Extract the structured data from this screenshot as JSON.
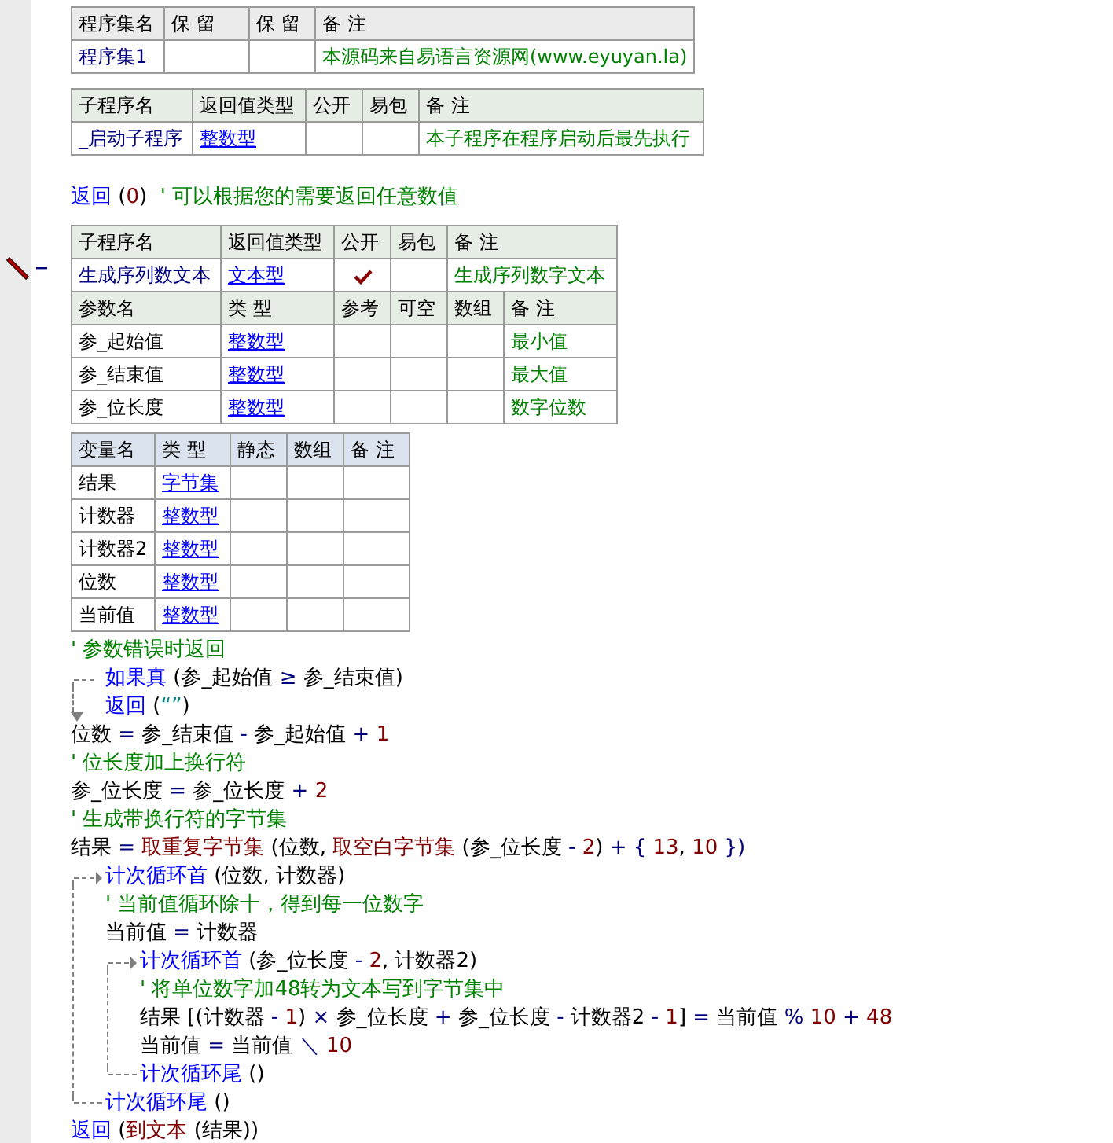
{
  "assembly": {
    "columns": [
      "程序集名",
      "保 留",
      "保 留",
      "备 注"
    ],
    "name": "程序集1",
    "remark": "本源码来自易语言资源网(www.eyuyan.la)"
  },
  "startup_sub": {
    "columns": [
      "子程序名",
      "返回值类型",
      "公开",
      "易包",
      "备 注"
    ],
    "name": "_启动子程序",
    "return_type": "整数型",
    "public": false,
    "easy_package": false,
    "remark": "本子程序在程序启动后最先执行"
  },
  "startup_code": [
    {
      "kind": "line",
      "tokens": [
        {
          "text": "返回",
          "kind": "kw"
        },
        {
          "text": " (",
          "kind": "p"
        },
        {
          "text": "0",
          "kind": "num"
        },
        {
          "text": ")",
          "kind": "p"
        },
        {
          "text": "  ' 可以根据您的需要返回任意数值",
          "kind": "cm"
        }
      ]
    }
  ],
  "sub": {
    "columns": [
      "子程序名",
      "返回值类型",
      "公开",
      "易包",
      "备 注"
    ],
    "name": "生成序列数文本",
    "return_type": "文本型",
    "public": true,
    "easy_package": false,
    "remark": "生成序列数字文本",
    "param_columns": [
      "参数名",
      "类 型",
      "参考",
      "可空",
      "数组",
      "备 注"
    ],
    "params": [
      {
        "name": "参_起始值",
        "type": "整数型",
        "by_ref": false,
        "optional": false,
        "array": false,
        "remark": "最小值"
      },
      {
        "name": "参_结束值",
        "type": "整数型",
        "by_ref": false,
        "optional": false,
        "array": false,
        "remark": "最大值"
      },
      {
        "name": "参_位长度",
        "type": "整数型",
        "by_ref": false,
        "optional": false,
        "array": false,
        "remark": "数字位数"
      }
    ]
  },
  "locals": {
    "columns": [
      "变量名",
      "类 型",
      "静态",
      "数组",
      "备 注"
    ],
    "vars": [
      {
        "name": "结果",
        "type": "字节集",
        "static": false,
        "array": false
      },
      {
        "name": "计数器",
        "type": "整数型",
        "static": false,
        "array": false
      },
      {
        "name": "计数器2",
        "type": "整数型",
        "static": false,
        "array": false
      },
      {
        "name": "位数",
        "type": "整数型",
        "static": false,
        "array": false
      },
      {
        "name": "当前值",
        "type": "整数型",
        "static": false,
        "array": false
      }
    ]
  },
  "code": [
    {
      "kind": "line",
      "tokens": [
        {
          "text": "' 参数错误时返回",
          "kind": "cm"
        }
      ]
    },
    {
      "kind": "if",
      "tokens": [
        {
          "text": "如果真",
          "kind": "kw"
        },
        {
          "text": " (",
          "kind": "p"
        },
        {
          "text": "参_起始值",
          "kind": "id"
        },
        {
          "text": " ≥ ",
          "kind": "op"
        },
        {
          "text": "参_结束值",
          "kind": "id"
        },
        {
          "text": ")",
          "kind": "p"
        }
      ],
      "children": [
        {
          "kind": "line",
          "tokens": [
            {
              "text": "返回",
              "kind": "kw"
            },
            {
              "text": " (",
              "kind": "p"
            },
            {
              "text": "“”",
              "kind": "str"
            },
            {
              "text": ")",
              "kind": "p"
            }
          ]
        }
      ]
    },
    {
      "kind": "line",
      "tokens": [
        {
          "text": "位数",
          "kind": "id"
        },
        {
          "text": " = ",
          "kind": "op"
        },
        {
          "text": "参_结束值",
          "kind": "id"
        },
        {
          "text": " - ",
          "kind": "op"
        },
        {
          "text": "参_起始值",
          "kind": "id"
        },
        {
          "text": " + ",
          "kind": "op"
        },
        {
          "text": "1",
          "kind": "num"
        }
      ]
    },
    {
      "kind": "line",
      "tokens": [
        {
          "text": "' 位长度加上换行符",
          "kind": "cm"
        }
      ]
    },
    {
      "kind": "line",
      "tokens": [
        {
          "text": "参_位长度",
          "kind": "id"
        },
        {
          "text": " = ",
          "kind": "op"
        },
        {
          "text": "参_位长度",
          "kind": "id"
        },
        {
          "text": " + ",
          "kind": "op"
        },
        {
          "text": "2",
          "kind": "num"
        }
      ]
    },
    {
      "kind": "line",
      "tokens": [
        {
          "text": "' 生成带换行符的字节集",
          "kind": "cm"
        }
      ]
    },
    {
      "kind": "line",
      "tokens": [
        {
          "text": "结果",
          "kind": "id"
        },
        {
          "text": " = ",
          "kind": "op"
        },
        {
          "text": "取重复字节集",
          "kind": "fn"
        },
        {
          "text": " (位数, ",
          "kind": "p"
        },
        {
          "text": "取空白字节集",
          "kind": "fn"
        },
        {
          "text": " (参_位长度",
          "kind": "p"
        },
        {
          "text": " - ",
          "kind": "op"
        },
        {
          "text": "2",
          "kind": "num"
        },
        {
          "text": ")",
          "kind": "p"
        },
        {
          "text": " + { ",
          "kind": "op"
        },
        {
          "text": "13",
          "kind": "num"
        },
        {
          "text": ", ",
          "kind": "p"
        },
        {
          "text": "10",
          "kind": "num"
        },
        {
          "text": " })",
          "kind": "op"
        }
      ]
    },
    {
      "kind": "loop",
      "tokens": [
        {
          "text": "计次循环首",
          "kind": "kw"
        },
        {
          "text": " (位数, 计数器)",
          "kind": "p"
        }
      ],
      "children": [
        {
          "kind": "line",
          "tokens": [
            {
              "text": "' 当前值循环除十，得到每一位数字",
              "kind": "cm"
            }
          ]
        },
        {
          "kind": "line",
          "tokens": [
            {
              "text": "当前值",
              "kind": "id"
            },
            {
              "text": " = ",
              "kind": "op"
            },
            {
              "text": "计数器",
              "kind": "id"
            }
          ]
        },
        {
          "kind": "loop",
          "tokens": [
            {
              "text": "计次循环首",
              "kind": "kw"
            },
            {
              "text": " (参_位长度",
              "kind": "p"
            },
            {
              "text": " - ",
              "kind": "op"
            },
            {
              "text": "2",
              "kind": "num"
            },
            {
              "text": ", 计数器2)",
              "kind": "p"
            }
          ],
          "children": [
            {
              "kind": "line",
              "tokens": [
                {
                  "text": "' 将单位数字加48转为文本写到字节集中",
                  "kind": "cm"
                }
              ]
            },
            {
              "kind": "line",
              "tokens": [
                {
                  "text": "结果 [(计数器",
                  "kind": "id"
                },
                {
                  "text": " - ",
                  "kind": "op"
                },
                {
                  "text": "1",
                  "kind": "num"
                },
                {
                  "text": ")",
                  "kind": "p"
                },
                {
                  "text": " × ",
                  "kind": "op"
                },
                {
                  "text": "参_位长度",
                  "kind": "id"
                },
                {
                  "text": " + ",
                  "kind": "op"
                },
                {
                  "text": "参_位长度",
                  "kind": "id"
                },
                {
                  "text": " - ",
                  "kind": "op"
                },
                {
                  "text": "计数器2",
                  "kind": "id"
                },
                {
                  "text": " - ",
                  "kind": "op"
                },
                {
                  "text": "1",
                  "kind": "num"
                },
                {
                  "text": "]",
                  "kind": "p"
                },
                {
                  "text": " = ",
                  "kind": "op"
                },
                {
                  "text": "当前值",
                  "kind": "id"
                },
                {
                  "text": " % ",
                  "kind": "op"
                },
                {
                  "text": "10",
                  "kind": "num"
                },
                {
                  "text": " + ",
                  "kind": "op"
                },
                {
                  "text": "48",
                  "kind": "num"
                }
              ]
            },
            {
              "kind": "line",
              "tokens": [
                {
                  "text": "当前值",
                  "kind": "id"
                },
                {
                  "text": " = ",
                  "kind": "op"
                },
                {
                  "text": "当前值",
                  "kind": "id"
                },
                {
                  "text": " ＼ ",
                  "kind": "op"
                },
                {
                  "text": "10",
                  "kind": "num"
                }
              ]
            }
          ],
          "end": [
            {
              "text": "计次循环尾",
              "kind": "kw"
            },
            {
              "text": " ()",
              "kind": "p"
            }
          ]
        }
      ],
      "end": [
        {
          "text": "计次循环尾",
          "kind": "kw"
        },
        {
          "text": " ()",
          "kind": "p"
        }
      ]
    },
    {
      "kind": "line",
      "tokens": [
        {
          "text": "返回",
          "kind": "kw"
        },
        {
          "text": " (",
          "kind": "p"
        },
        {
          "text": "到文本",
          "kind": "fn"
        },
        {
          "text": " (结果))",
          "kind": "p"
        }
      ]
    }
  ]
}
